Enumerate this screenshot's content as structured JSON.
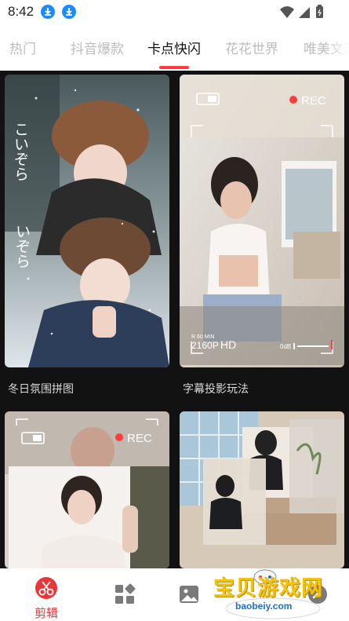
{
  "status_bar": {
    "time": "8:42",
    "icons": [
      "download-icon",
      "download-icon",
      "wifi-icon",
      "signal-icon",
      "battery-icon"
    ]
  },
  "tabs": [
    {
      "label": "热门",
      "active": false
    },
    {
      "label": "抖音爆款",
      "active": false
    },
    {
      "label": "卡点快闪",
      "active": true
    },
    {
      "label": "花花世界",
      "active": false
    },
    {
      "label": "唯美文艺",
      "active": false
    }
  ],
  "cards": [
    {
      "caption": "冬日氛围拼图",
      "overlay_text": "こいぞら いぞら"
    },
    {
      "caption": "字幕投影玩法",
      "overlay": {
        "rec": "REC",
        "resolution_top": "R 60 MIN",
        "resolution": "2160P",
        "hd": "HD",
        "db": "0dB"
      }
    },
    {
      "caption": "",
      "overlay": {
        "rec": "REC"
      }
    },
    {
      "caption": ""
    }
  ],
  "bottom_nav": {
    "items": [
      {
        "label": "剪辑",
        "icon": "scissors-icon",
        "active": true
      },
      {
        "label": "",
        "icon": "templates-icon",
        "active": false
      },
      {
        "label": "",
        "icon": "image-icon",
        "active": false
      },
      {
        "label": "",
        "icon": "profile-icon",
        "active": false
      }
    ]
  },
  "watermark": {
    "title": "宝贝游戏网",
    "url": "baobeiy.com"
  },
  "colors": {
    "accent": "#ff3b3b",
    "nav_active": "#e8373b",
    "background": "#121212"
  }
}
